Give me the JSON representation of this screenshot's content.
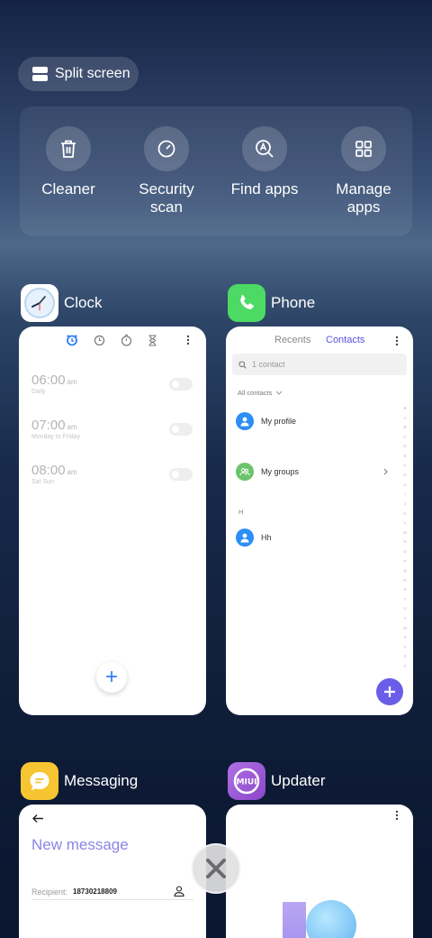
{
  "split_screen": {
    "label": "Split screen"
  },
  "tools": [
    {
      "label": "Cleaner",
      "icon": "trash-icon"
    },
    {
      "label": "Security\nscan",
      "icon": "security-scan-icon"
    },
    {
      "label": "Find apps",
      "icon": "find-apps-icon"
    },
    {
      "label": "Manage\napps",
      "icon": "grid-icon"
    }
  ],
  "apps": {
    "clock": {
      "name": "Clock",
      "alarms": [
        {
          "time": "06:00",
          "ampm": "am",
          "repeat": "Daily"
        },
        {
          "time": "07:00",
          "ampm": "am",
          "repeat": "Monday to Friday"
        },
        {
          "time": "08:00",
          "ampm": "am",
          "repeat": "Sat Sun"
        }
      ],
      "add_label": "+"
    },
    "phone": {
      "name": "Phone",
      "tabs": {
        "recents": "Recents",
        "contacts": "Contacts"
      },
      "search_placeholder": "1 contact",
      "filter_label": "All contacts",
      "rows": {
        "profile": "My profile",
        "groups": "My groups",
        "section": "H",
        "contact": "Hh"
      },
      "index": [
        "♥",
        "A",
        "B",
        "C",
        "D",
        "E",
        "F",
        "G",
        "H",
        "I",
        "J",
        "K",
        "L",
        "M",
        "N",
        "O",
        "P",
        "Q",
        "R",
        "S",
        "T",
        "U",
        "V",
        "W",
        "X",
        "Y",
        "Z",
        "#"
      ],
      "accent": "#5b52e0"
    },
    "messaging": {
      "name": "Messaging",
      "title": "New message",
      "recipient_label": "Recipient:",
      "recipient_value": "18730218809"
    },
    "updater": {
      "name": "Updater",
      "icon_text": "MIUI"
    }
  },
  "colors": {
    "clock_accent": "#2e7cf6",
    "phone_icon": "#4cd964",
    "messaging_icon": "#f7c531",
    "updater_icon": "#9b59d0"
  }
}
